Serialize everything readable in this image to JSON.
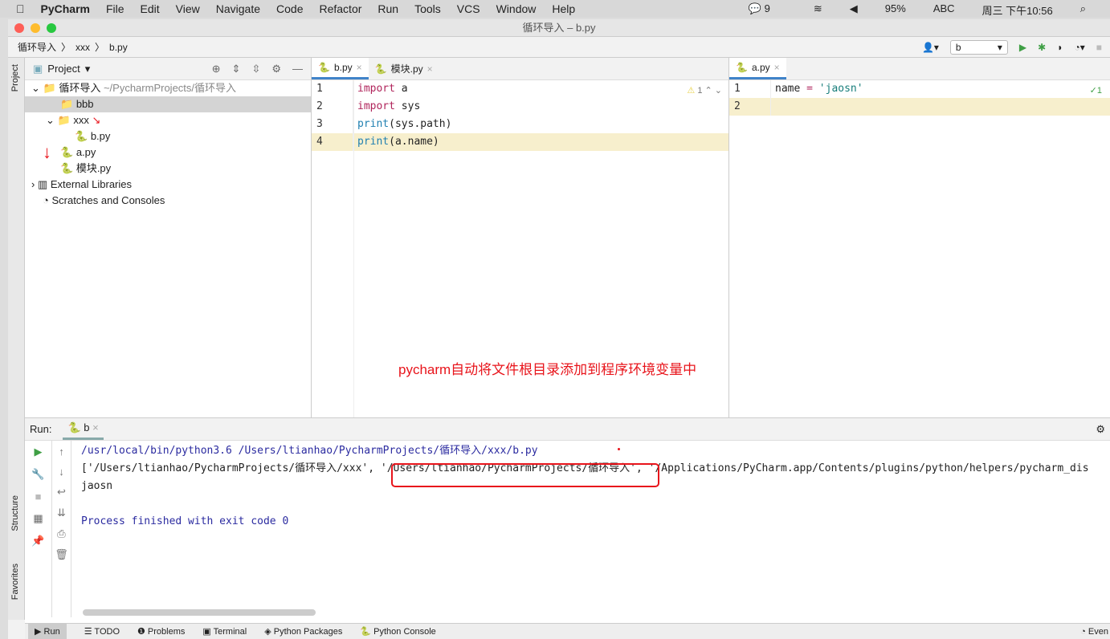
{
  "menubar": {
    "app": "PyCharm",
    "items": [
      "File",
      "Edit",
      "View",
      "Navigate",
      "Code",
      "Refactor",
      "Run",
      "Tools",
      "VCS",
      "Window",
      "Help"
    ],
    "wechat_count": "9",
    "battery": "95%",
    "input": "ABC",
    "clock": "周三 下午10:56"
  },
  "window": {
    "title": "循环导入 – b.py"
  },
  "breadcrumb": [
    "循环导入",
    "xxx",
    "b.py"
  ],
  "run_config": "b",
  "sidebar": {
    "project": "Project",
    "structure": "Structure",
    "favorites": "Favorites"
  },
  "project": {
    "header": "Project",
    "root": "循环导入",
    "root_path": "~/PycharmProjects/循环导入",
    "items": [
      "bbb",
      "xxx",
      "b.py",
      "a.py",
      "模块.py",
      "External Libraries",
      "Scratches and Consoles"
    ]
  },
  "editor_left": {
    "tabs": [
      "b.py",
      "模块.py"
    ],
    "warnings": "1",
    "lines": [
      [
        {
          "t": "import",
          "c": "kw"
        },
        {
          "t": " a",
          "c": ""
        }
      ],
      [
        {
          "t": "import",
          "c": "kw"
        },
        {
          "t": " sys",
          "c": ""
        }
      ],
      [
        {
          "t": "print",
          "c": "fn"
        },
        {
          "t": "(sys.path)",
          "c": ""
        }
      ],
      [
        {
          "t": "print",
          "c": "fn"
        },
        {
          "t": "(a.name)",
          "c": ""
        }
      ]
    ]
  },
  "editor_right": {
    "tabs": [
      "a.py"
    ],
    "lines": [
      [
        {
          "t": "name ",
          "c": ""
        },
        {
          "t": "=",
          "c": "op"
        },
        {
          "t": " 'jaosn'",
          "c": "str"
        }
      ],
      []
    ]
  },
  "annotation": "pycharm自动将文件根目录添加到程序环境变量中",
  "run": {
    "label": "Run:",
    "tab": "b",
    "output": [
      "/usr/local/bin/python3.6 /Users/ltianhao/PycharmProjects/循环导入/xxx/b.py",
      "['/Users/ltianhao/PycharmProjects/循环导入/xxx', '/Users/ltianhao/PycharmProjects/循环导入', '/Applications/PyCharm.app/Contents/plugins/python/helpers/pycharm_dis",
      "jaosn",
      "",
      "Process finished with exit code 0"
    ]
  },
  "bottom": [
    "Run",
    "TODO",
    "Problems",
    "Terminal",
    "Python Packages",
    "Python Console",
    "Even"
  ],
  "colors": {
    "annotation": "#e8141b",
    "tab_accent": "#4083c9",
    "run_green": "#3f9f45",
    "current_line": "#f7efcd"
  }
}
